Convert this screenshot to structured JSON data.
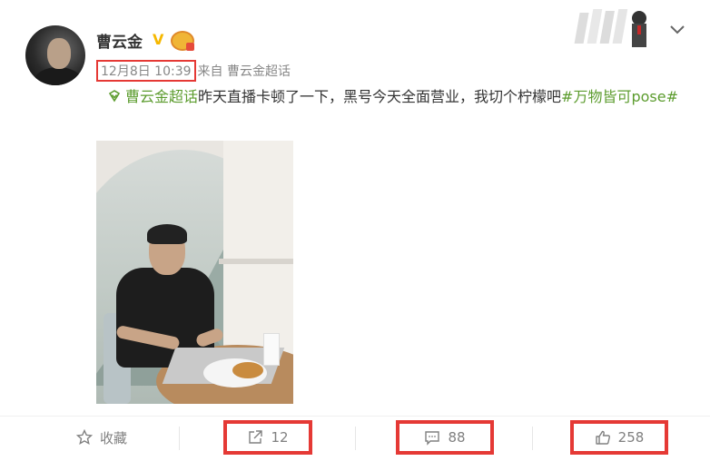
{
  "post": {
    "author": "曹云金",
    "timestamp": "12月8日 10:39",
    "source": "来自 曹云金超话",
    "supertopic_link": "曹云金超话",
    "body_text": "昨天直播卡顿了一下，黑号今天全面营业，我切个柠檬吧",
    "hashtag": "#万物皆可pose#"
  },
  "icons": {
    "verified": "verified-v-icon",
    "level": "member-level-icon",
    "supertopic": "supertopic-diamond-icon",
    "more": "chevron-down-icon",
    "favorite": "star-icon",
    "repost": "share-icon",
    "comment": "comment-icon",
    "like": "thumbs-up-icon"
  },
  "actions": {
    "favorite_label": "收藏",
    "repost_count": "12",
    "comment_count": "88",
    "like_count": "258"
  },
  "colors": {
    "link_green": "#5c9c2e",
    "highlight_red": "#e53935",
    "verified_gold": "#f6b800"
  }
}
